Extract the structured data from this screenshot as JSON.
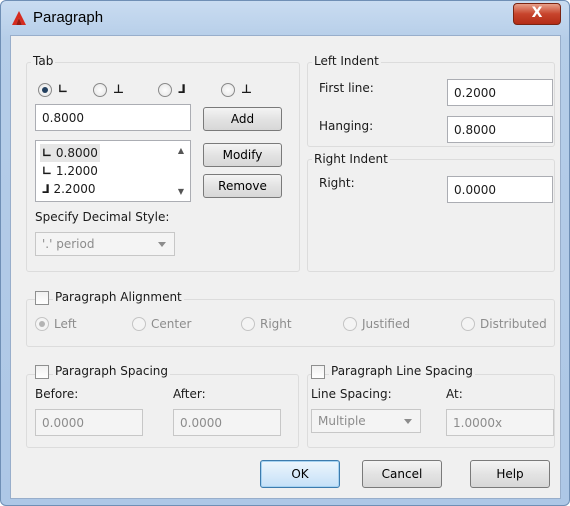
{
  "window": {
    "title": "Paragraph",
    "close_glyph": "X"
  },
  "tab": {
    "group_label": "Tab",
    "value": "0.8000",
    "add_label": "Add",
    "modify_label": "Modify",
    "remove_label": "Remove",
    "stops": [
      {
        "glyph": "∟",
        "value": "0.8000"
      },
      {
        "glyph": "∟",
        "value": "1.2000"
      },
      {
        "glyph": "⅃",
        "value": "2.2000"
      }
    ],
    "decimal_label": "Specify Decimal Style:",
    "decimal_value": "'.' period"
  },
  "left_indent": {
    "group_label": "Left Indent",
    "first_line_label": "First line:",
    "first_line_value": "0.2000",
    "hanging_label": "Hanging:",
    "hanging_value": "0.8000"
  },
  "right_indent": {
    "group_label": "Right Indent",
    "right_label": "Right:",
    "right_value": "0.0000"
  },
  "alignment": {
    "group_label": "Paragraph Alignment",
    "options": [
      "Left",
      "Center",
      "Right",
      "Justified",
      "Distributed"
    ]
  },
  "spacing": {
    "group_label": "Paragraph Spacing",
    "before_label": "Before:",
    "before_value": "0.0000",
    "after_label": "After:",
    "after_value": "0.0000"
  },
  "line_spacing": {
    "group_label": "Paragraph Line Spacing",
    "line_label": "Line Spacing:",
    "line_value": "Multiple",
    "at_label": "At:",
    "at_value": "1.0000x"
  },
  "buttons": {
    "ok": "OK",
    "cancel": "Cancel",
    "help": "Help"
  },
  "colors": {
    "accent": "#3d7bad",
    "close": "#c7442c",
    "app_icon": "#d62b1f"
  }
}
